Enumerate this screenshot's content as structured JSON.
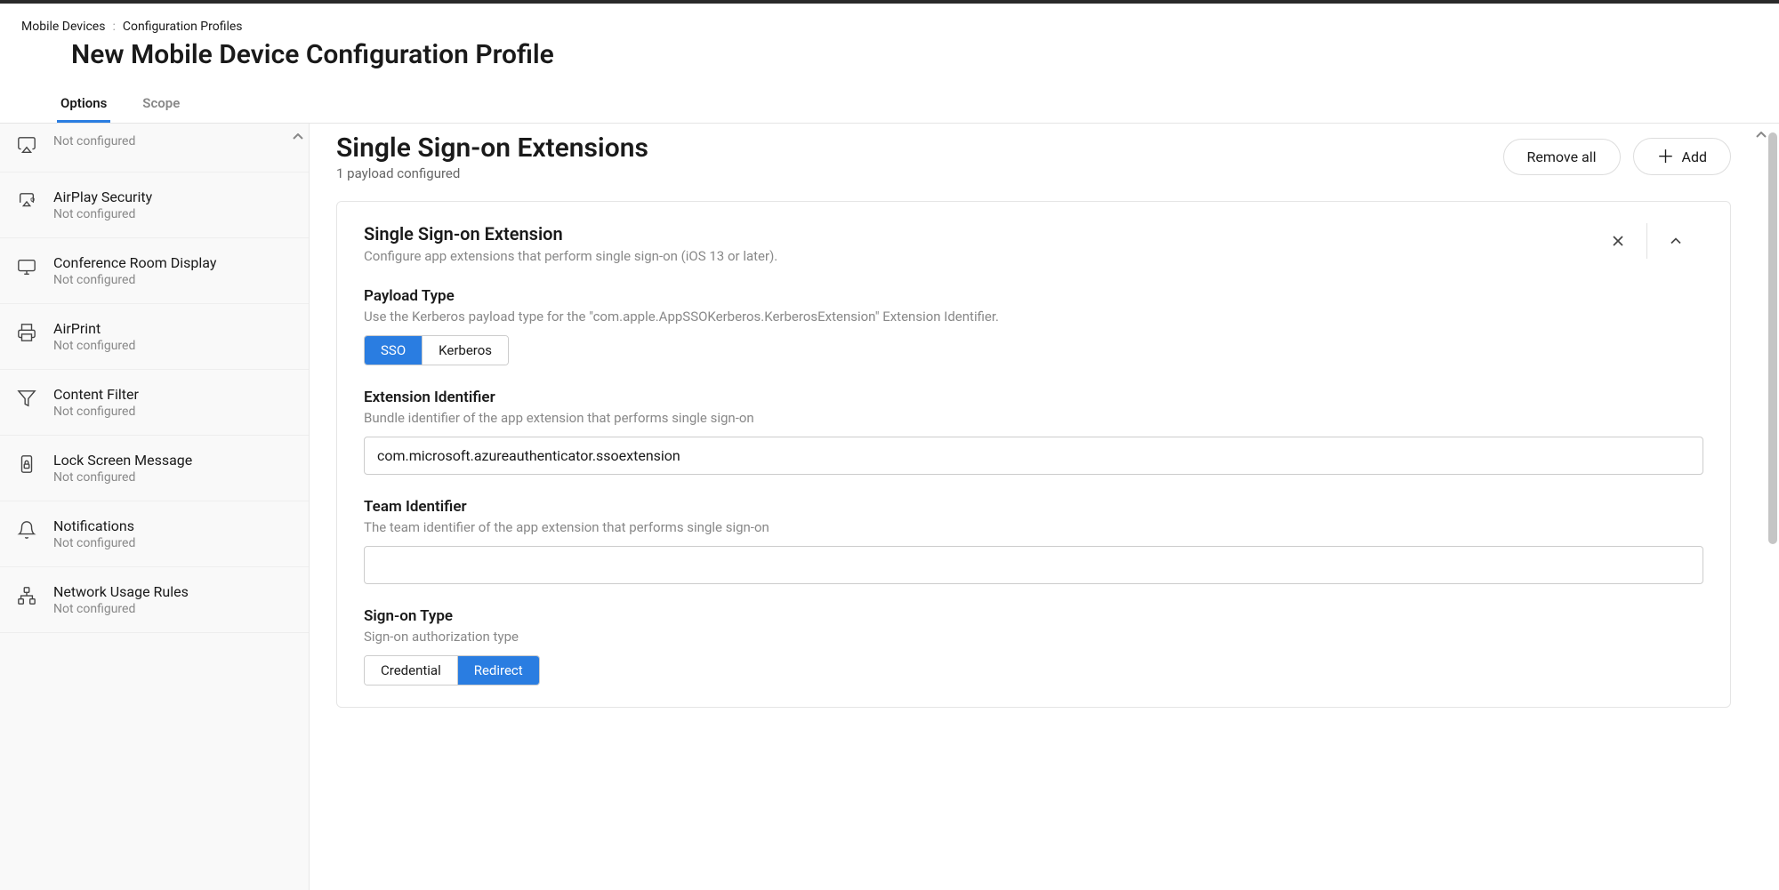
{
  "breadcrumb": {
    "item1": "Mobile Devices",
    "item2": "Configuration Profiles"
  },
  "page_title": "New Mobile Device Configuration Profile",
  "tabs": {
    "options": "Options",
    "scope": "Scope"
  },
  "sidebar": {
    "items": [
      {
        "label": "",
        "status": "Not configured",
        "icon": "airplay"
      },
      {
        "label": "AirPlay Security",
        "status": "Not configured",
        "icon": "airplay-shield"
      },
      {
        "label": "Conference Room Display",
        "status": "Not configured",
        "icon": "display"
      },
      {
        "label": "AirPrint",
        "status": "Not configured",
        "icon": "printer"
      },
      {
        "label": "Content Filter",
        "status": "Not configured",
        "icon": "filter"
      },
      {
        "label": "Lock Screen Message",
        "status": "Not configured",
        "icon": "phone-lock"
      },
      {
        "label": "Notifications",
        "status": "Not configured",
        "icon": "bell"
      },
      {
        "label": "Network Usage Rules",
        "status": "Not configured",
        "icon": "network"
      }
    ]
  },
  "section": {
    "title": "Single Sign-on Extensions",
    "subtitle": "1 payload configured",
    "remove_all": "Remove all",
    "add": "Add"
  },
  "card": {
    "title": "Single Sign-on Extension",
    "desc": "Configure app extensions that perform single sign-on (iOS 13 or later)."
  },
  "fields": {
    "payload_type": {
      "label": "Payload Type",
      "desc": "Use the Kerberos payload type for the \"com.apple.AppSSOKerberos.KerberosExtension\" Extension Identifier.",
      "opt_sso": "SSO",
      "opt_kerberos": "Kerberos"
    },
    "extension_id": {
      "label": "Extension Identifier",
      "desc": "Bundle identifier of the app extension that performs single sign-on",
      "value": "com.microsoft.azureauthenticator.ssoextension"
    },
    "team_id": {
      "label": "Team Identifier",
      "desc": "The team identifier of the app extension that performs single sign-on",
      "value": ""
    },
    "signon_type": {
      "label": "Sign-on Type",
      "desc": "Sign-on authorization type",
      "opt_credential": "Credential",
      "opt_redirect": "Redirect"
    }
  }
}
